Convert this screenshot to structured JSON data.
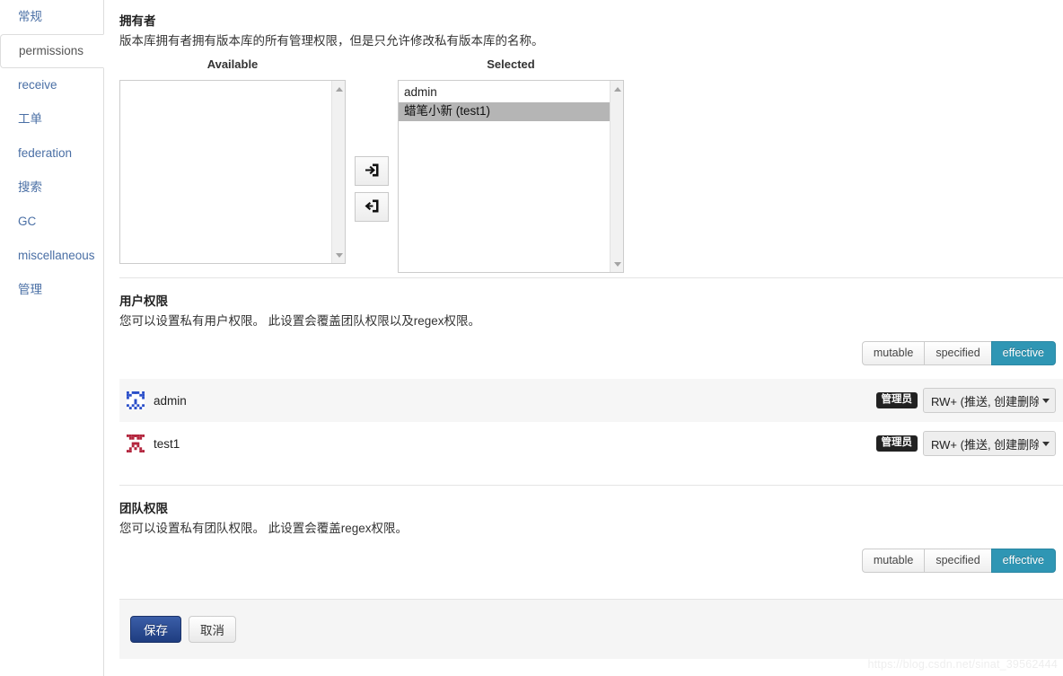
{
  "sidebar": {
    "items": [
      {
        "label": "常规",
        "active": false
      },
      {
        "label": "permissions",
        "active": true
      },
      {
        "label": "receive",
        "active": false
      },
      {
        "label": "工单",
        "active": false
      },
      {
        "label": "federation",
        "active": false
      },
      {
        "label": "搜索",
        "active": false
      },
      {
        "label": "GC",
        "active": false
      },
      {
        "label": "miscellaneous",
        "active": false
      },
      {
        "label": "管理",
        "active": false
      }
    ]
  },
  "owner": {
    "title": "拥有者",
    "description": "版本库拥有者拥有版本库的所有管理权限，但是只允许修改私有版本库的名称。",
    "available_label": "Available",
    "selected_label": "Selected",
    "available_items": [],
    "selected_items": [
      {
        "label": "admin",
        "selected": false
      },
      {
        "label": "蜡笔小新 (test1)",
        "selected": true
      }
    ],
    "add_icon": "arrow-into-box-icon",
    "remove_icon": "arrow-return-icon"
  },
  "user_permissions": {
    "title": "用户权限",
    "description": "您可以设置私有用户权限。 此设置会覆盖团队权限以及regex权限。",
    "view_modes": [
      {
        "label": "mutable",
        "active": false
      },
      {
        "label": "specified",
        "active": false
      },
      {
        "label": "effective",
        "active": true
      }
    ],
    "rows": [
      {
        "name": "admin",
        "badge": "管理员",
        "permission": "RW+ (推送, 创建删除",
        "avatar_icon": "identicon-blue-avatar"
      },
      {
        "name": "test1",
        "badge": "管理员",
        "permission": "RW+ (推送, 创建删除",
        "avatar_icon": "identicon-red-avatar"
      }
    ]
  },
  "team_permissions": {
    "title": "团队权限",
    "description": "您可以设置私有团队权限。 此设置会覆盖regex权限。",
    "view_modes": [
      {
        "label": "mutable",
        "active": false
      },
      {
        "label": "specified",
        "active": false
      },
      {
        "label": "effective",
        "active": true
      }
    ],
    "rows": []
  },
  "footer": {
    "save_label": "保存",
    "cancel_label": "取消"
  },
  "watermark": "https://blog.csdn.net/sinat_39562444",
  "colors": {
    "accent": "#2f96b4",
    "primary_button": "#1f3d80",
    "link": "#4a6fa5",
    "badge": "#222222",
    "row_alt": "#f6f6f6",
    "footer_bg": "#f5f5f5"
  }
}
